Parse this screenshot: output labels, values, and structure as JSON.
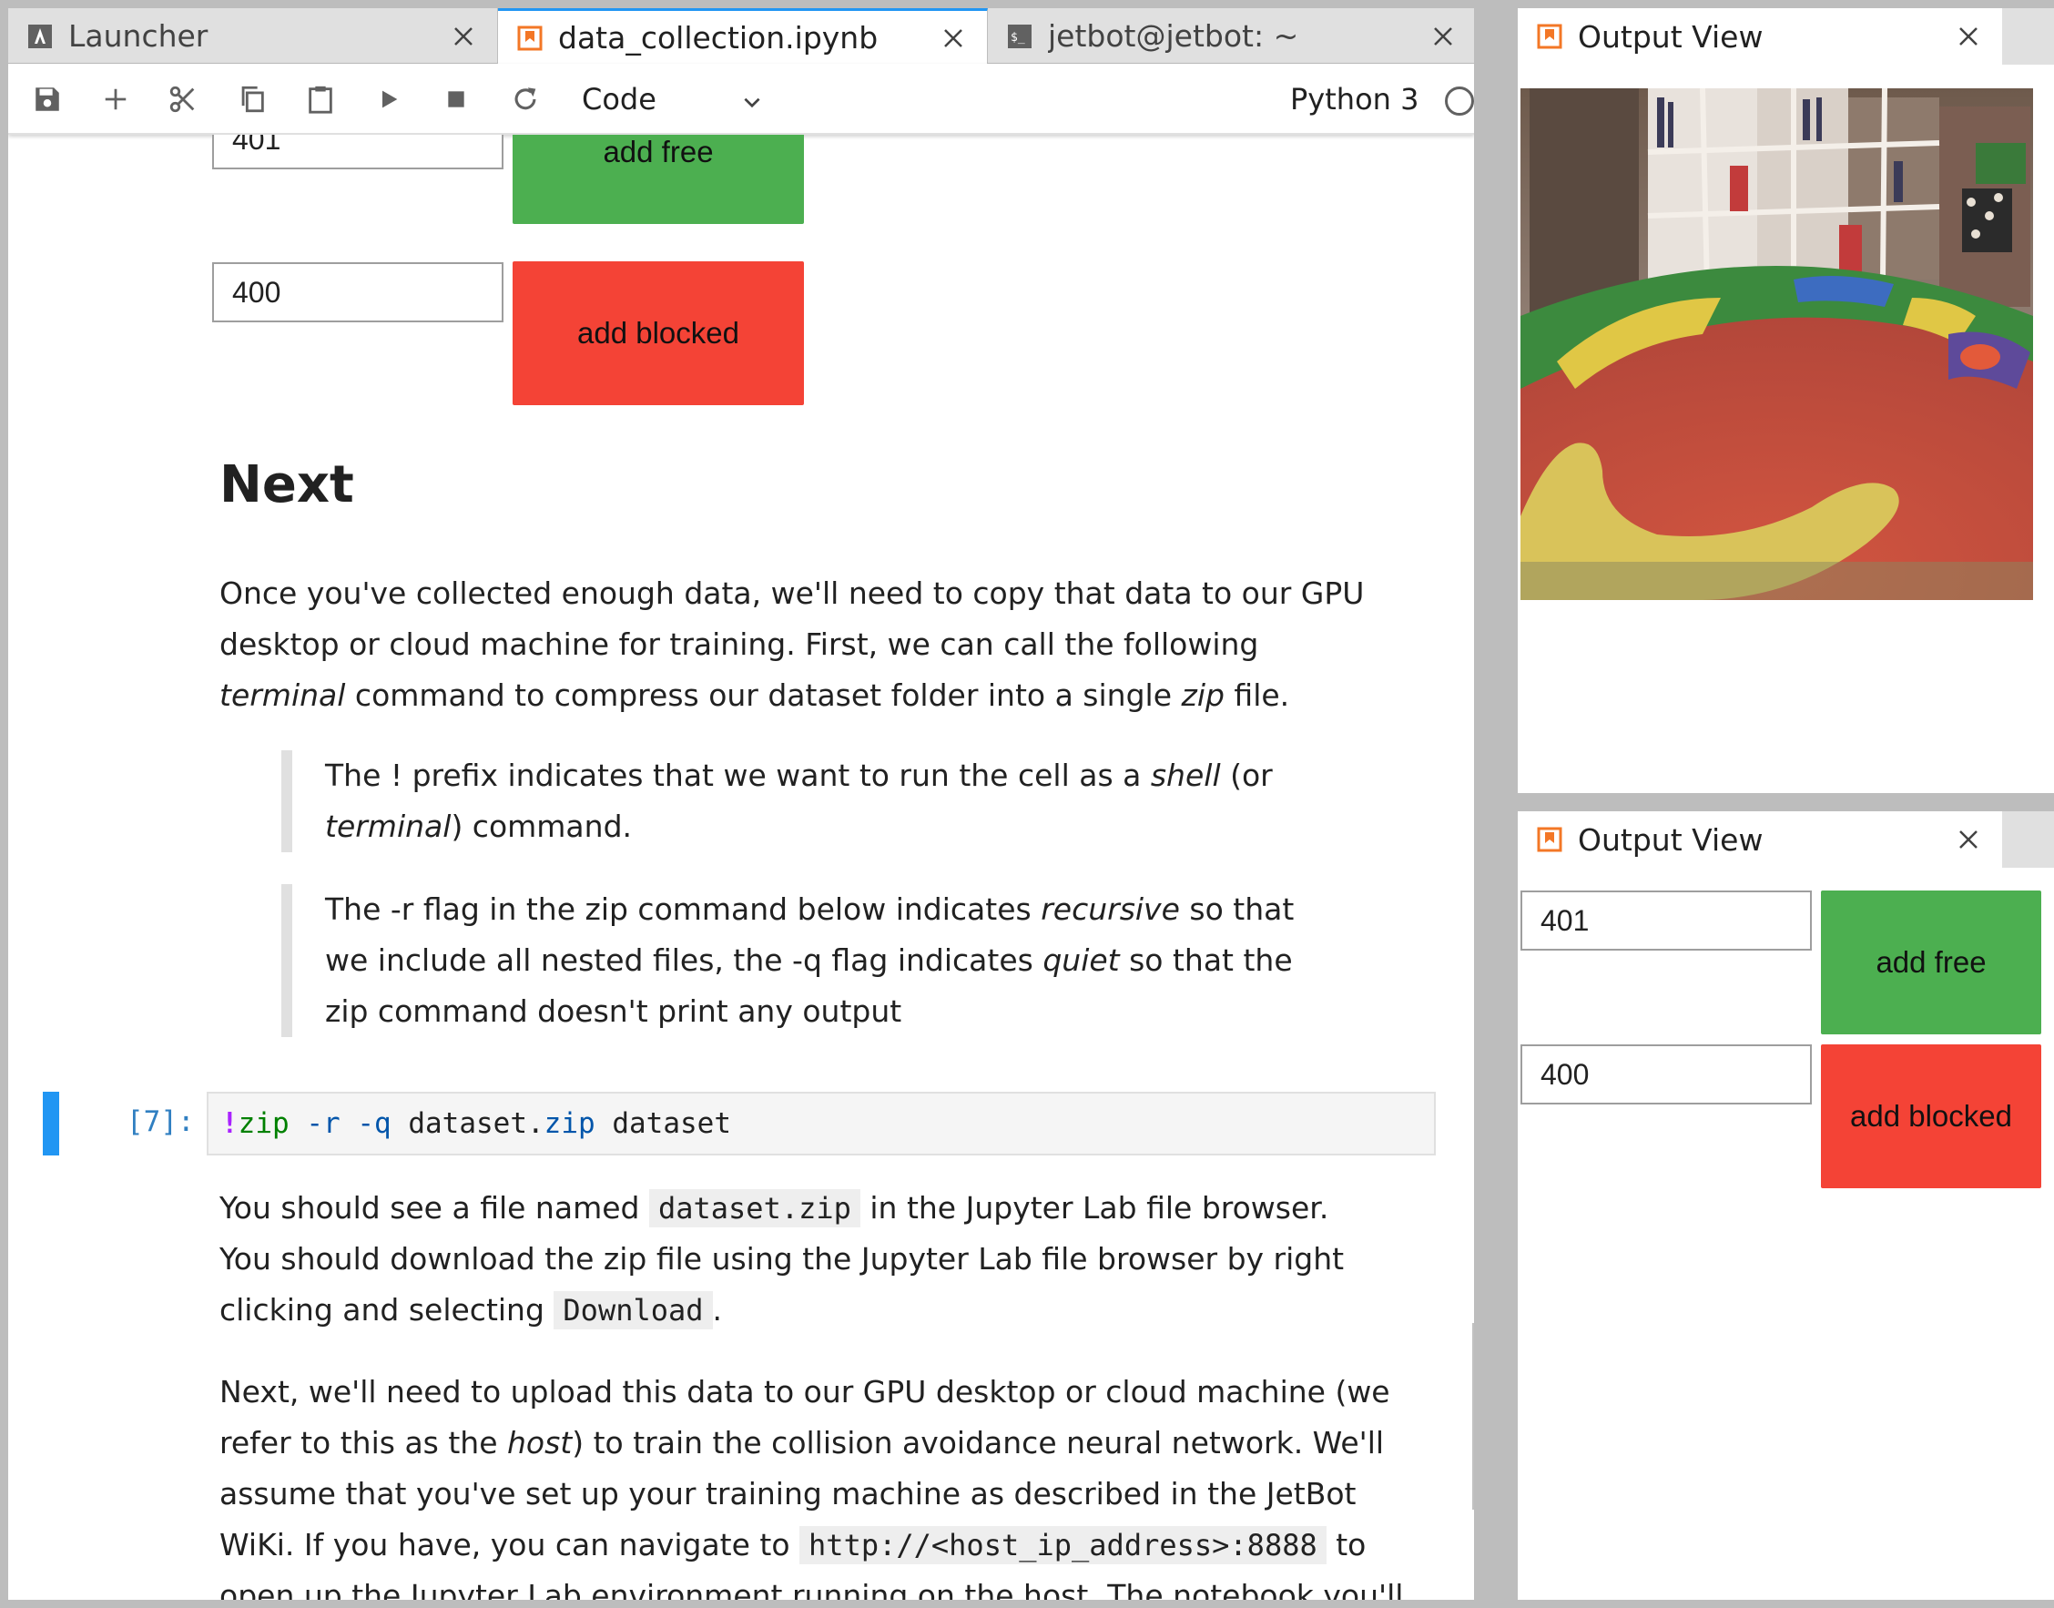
{
  "tabs": [
    {
      "label": "Launcher",
      "icon": "launcher-icon"
    },
    {
      "label": "data_collection.ipynb",
      "icon": "notebook-icon"
    },
    {
      "label": "jetbot@jetbot: ~",
      "icon": "terminal-icon"
    }
  ],
  "toolbar": {
    "cell_type": "Code",
    "kernel": "Python 3"
  },
  "widgets_top": {
    "free_count": "401",
    "free_label": "add free",
    "blocked_count": "400",
    "blocked_label": "add blocked"
  },
  "markdown": {
    "heading": "Next",
    "para1_a": "Once you've collected enough data, we'll need to copy that data to our GPU desktop or cloud machine for training. First, we can call the following ",
    "para1_terminal": "terminal",
    "para1_b": " command to compress our dataset folder into a single ",
    "para1_zip": "zip",
    "para1_c": " file.",
    "quote1_a": "The ! prefix indicates that we want to run the cell as a ",
    "quote1_shell": "shell",
    "quote1_b": " (or ",
    "quote1_terminal": "terminal",
    "quote1_c": ") command.",
    "quote2_a": "The -r flag in the zip command below indicates ",
    "quote2_recursive": "recursive",
    "quote2_b": " so that we include all nested files, the -q flag indicates ",
    "quote2_quiet": "quiet",
    "quote2_c": " so that the zip command doesn't print any output"
  },
  "code_cell": {
    "prompt": "[7]:",
    "bang": "!",
    "cmd": "zip",
    "flag_r": "-r",
    "flag_q": "-q",
    "arg1a": "dataset",
    "dot": ".",
    "arg1b": "zip",
    "arg2": "dataset"
  },
  "after": {
    "p1_a": "You should see a file named ",
    "p1_code": "dataset.zip",
    "p1_b": " in the Jupyter Lab file browser. You should download the zip file using the Jupyter Lab file browser by right clicking and selecting ",
    "p1_code2": "Download",
    "p1_c": ".",
    "p2_a": "Next, we'll need to upload this data to our GPU desktop or cloud machine (we refer to this as the ",
    "p2_host": "host",
    "p2_b": ") to train the collision avoidance neural network. We'll assume that you've set up your training machine as described in the JetBot WiKi. If you have, you can navigate to ",
    "p2_code": "http://<host_ip_address>:8888",
    "p2_c": " to open up the Jupyter Lab environment running on the host. The notebook you'll need to open"
  },
  "output_views": [
    {
      "title": "Output View"
    },
    {
      "title": "Output View"
    }
  ],
  "widgets_side": {
    "free_count": "401",
    "free_label": "add free",
    "blocked_count": "400",
    "blocked_label": "add blocked"
  },
  "colors": {
    "free": "#4caf50",
    "blocked": "#f44336",
    "accent": "#2196f3",
    "notebook_icon": "#f37726"
  }
}
